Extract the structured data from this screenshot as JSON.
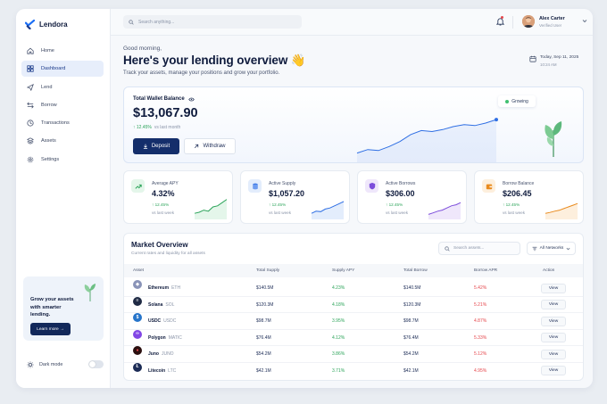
{
  "brand": {
    "name": "Lendora",
    "accent": "#1b6ef5",
    "navy": "#142e6b"
  },
  "sidebar": {
    "items": [
      {
        "label": "Home",
        "icon": "home-icon"
      },
      {
        "label": "Dashboard",
        "icon": "dashboard-icon",
        "active": true
      },
      {
        "label": "Lend",
        "icon": "send-icon"
      },
      {
        "label": "Borrow",
        "icon": "swap-icon"
      },
      {
        "label": "Transactions",
        "icon": "history-icon"
      },
      {
        "label": "Assets",
        "icon": "layers-icon"
      },
      {
        "label": "Settings",
        "icon": "gear-icon"
      }
    ],
    "promo": {
      "text": "Grow your assets with smarter lending.",
      "button": "Learn more →"
    },
    "dark_mode_label": "Dark mode",
    "dark_mode_on": false
  },
  "topbar": {
    "search_placeholder": "Search anything...",
    "user": {
      "name": "Alex Carter",
      "role": "Verified User"
    }
  },
  "header": {
    "greeting": "Good morning,",
    "title": "Here's your lending overview 👋",
    "subtitle": "Track your assets, manage your positions and grow your portfolio.",
    "date": "Today, Sep 11, 2025",
    "time": "10:24 AM"
  },
  "wallet": {
    "label": "Total Wallet Balance",
    "amount": "$13,067.90",
    "change": "↑ 12.45%",
    "change_note": "vs last month",
    "deposit": "Deposit",
    "withdraw": "Withdraw",
    "badge": "Growing",
    "trend": [
      0.15,
      0.22,
      0.2,
      0.28,
      0.38,
      0.52,
      0.6,
      0.58,
      0.62,
      0.68,
      0.72,
      0.7,
      0.75,
      0.82
    ]
  },
  "stats": [
    {
      "label": "Average APY",
      "value": "4.32%",
      "change": "↑ 12.45%",
      "note": "vs last week",
      "icon": "trend-up-icon",
      "color": "#2ca45a",
      "bg": "#e4f6ea",
      "trend": [
        0.2,
        0.25,
        0.35,
        0.3,
        0.5,
        0.55,
        0.7,
        0.85
      ]
    },
    {
      "label": "Active Supply",
      "value": "$1,057.20",
      "change": "↑ 12.45%",
      "note": "vs last week",
      "icon": "database-icon",
      "color": "#2f6fe4",
      "bg": "#e3edfc",
      "trend": [
        0.2,
        0.3,
        0.28,
        0.4,
        0.45,
        0.55,
        0.65,
        0.75
      ]
    },
    {
      "label": "Active Borrows",
      "value": "$306.00",
      "change": "↑ 12.45%",
      "note": "vs last week",
      "icon": "shield-icon",
      "color": "#7c4ddb",
      "bg": "#efe7fb",
      "trend": [
        0.15,
        0.22,
        0.3,
        0.35,
        0.45,
        0.55,
        0.6,
        0.7
      ]
    },
    {
      "label": "Borrow Balance",
      "value": "$206.45",
      "change": "↑ 12.45%",
      "note": "vs last week",
      "icon": "wallet-icon",
      "color": "#e98a1c",
      "bg": "#fdefdd",
      "trend": [
        0.2,
        0.24,
        0.3,
        0.34,
        0.42,
        0.5,
        0.58,
        0.66
      ]
    }
  ],
  "market": {
    "title": "Market Overview",
    "subtitle": "Current rates and liquidity for all assets",
    "search_placeholder": "Search assets...",
    "filter_label": "All Networks",
    "columns": [
      "Asset",
      "Total Supply",
      "Supply APY",
      "Total Borrow",
      "Borrow APR",
      "Action"
    ],
    "rows": [
      {
        "name": "Ethereum",
        "symbol": "ETH",
        "supply": "$140.5M",
        "apy": "4.23%",
        "borrow": "$140.5M",
        "apr": "5.42%",
        "action": "View",
        "coin_color": "#8a94b8",
        "glyph": "◆"
      },
      {
        "name": "Solana",
        "symbol": "SOL",
        "supply": "$120.3M",
        "apy": "4.18%",
        "borrow": "$120.3M",
        "apr": "5.21%",
        "action": "View",
        "coin_color": "#1f2a44",
        "glyph": "≡"
      },
      {
        "name": "USDC",
        "symbol": "USDC",
        "supply": "$98.7M",
        "apy": "3.95%",
        "borrow": "$98.7M",
        "apr": "4.87%",
        "action": "View",
        "coin_color": "#2775ca",
        "glyph": "$"
      },
      {
        "name": "Polygon",
        "symbol": "MATIC",
        "supply": "$76.4M",
        "apy": "4.12%",
        "borrow": "$76.4M",
        "apr": "5.33%",
        "action": "View",
        "coin_color": "#8247e5",
        "glyph": "∞"
      },
      {
        "name": "Juno",
        "symbol": "JUNO",
        "supply": "$54.2M",
        "apy": "3.86%",
        "borrow": "$54.2M",
        "apr": "5.12%",
        "action": "View",
        "coin_color": "#2b0f0f",
        "glyph": "●"
      },
      {
        "name": "Litecoin",
        "symbol": "LTC",
        "supply": "$42.1M",
        "apy": "3.71%",
        "borrow": "$42.1M",
        "apr": "4.95%",
        "action": "View",
        "coin_color": "#1b2b55",
        "glyph": "Ł"
      }
    ]
  }
}
